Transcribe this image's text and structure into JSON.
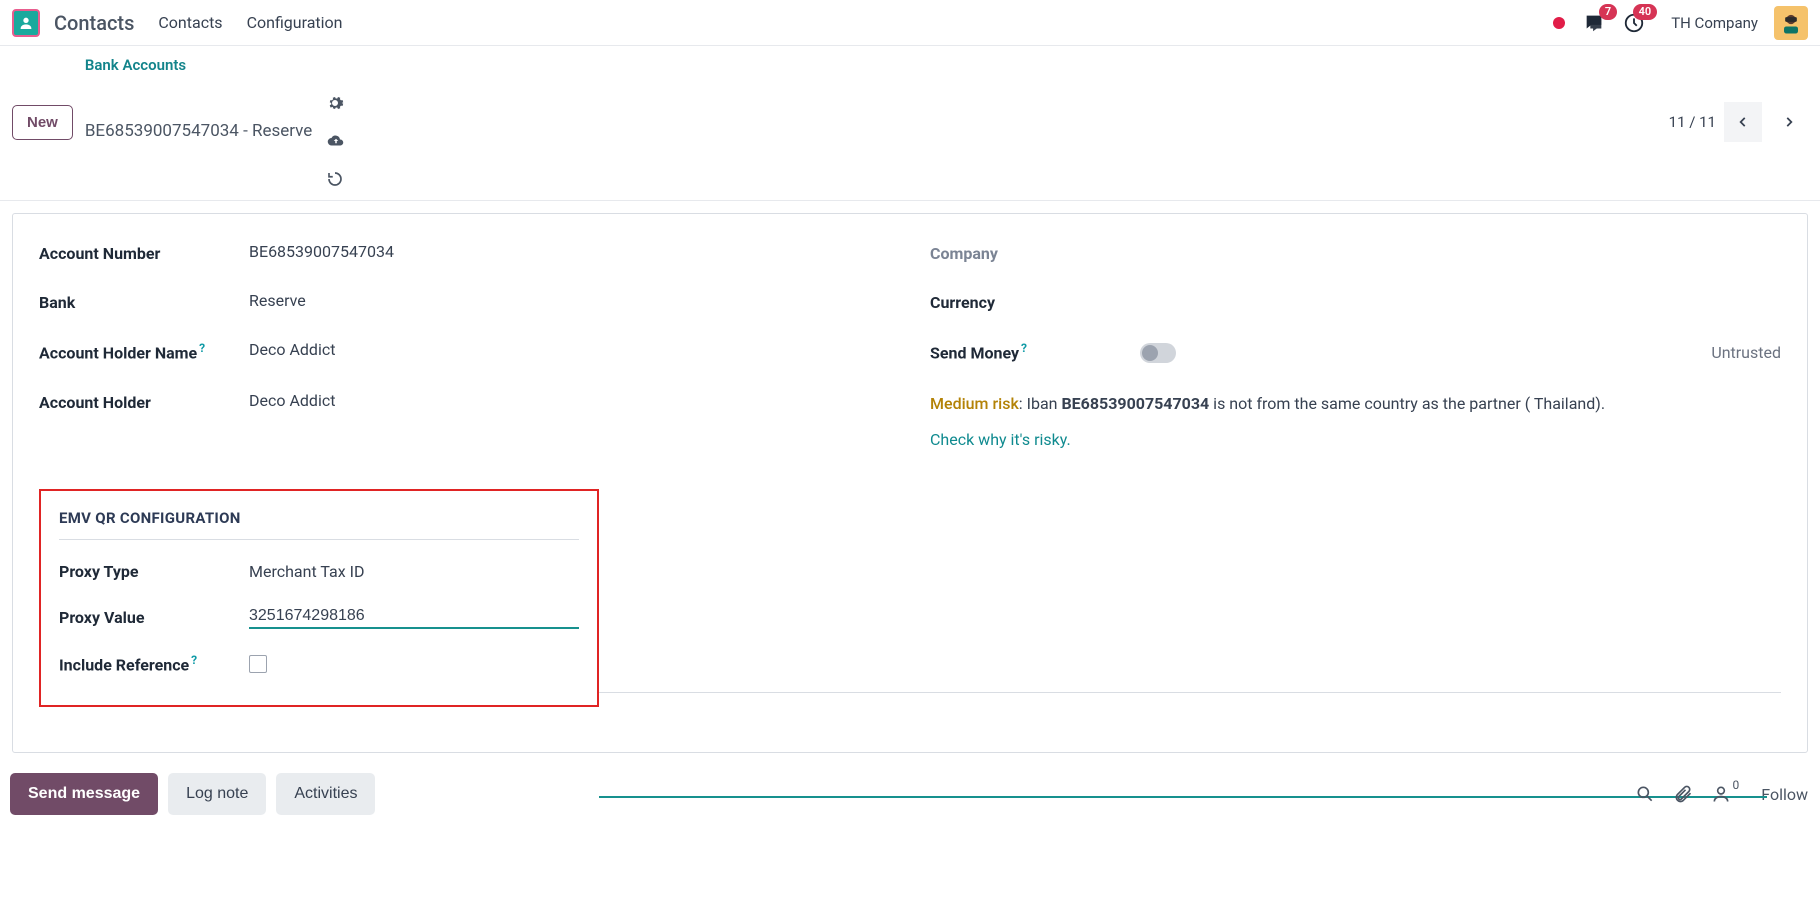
{
  "nav": {
    "app_name": "Contacts",
    "menu": [
      "Contacts",
      "Configuration"
    ],
    "messages_badge": "7",
    "activities_badge": "40",
    "company": "TH Company"
  },
  "breadcrumb": {
    "new_label": "New",
    "parent": "Bank Accounts",
    "current": "BE68539007547034 - Reserve"
  },
  "pager": {
    "text": "11 / 11"
  },
  "form": {
    "left": {
      "account_number": {
        "label": "Account Number",
        "value": "BE68539007547034"
      },
      "bank": {
        "label": "Bank",
        "value": "Reserve"
      },
      "holder_name": {
        "label": "Account Holder Name",
        "value": "Deco Addict"
      },
      "account_holder": {
        "label": "Account Holder",
        "value": "Deco Addict"
      }
    },
    "right": {
      "company": {
        "label": "Company",
        "value": ""
      },
      "currency": {
        "label": "Currency",
        "value": ""
      },
      "send_money": {
        "label": "Send Money",
        "status": "Untrusted"
      },
      "risk": {
        "level": "Medium risk",
        "sep": ": Iban ",
        "iban": "BE68539007547034",
        "tail": " is not from the same country as the partner ( Thailand).",
        "link": "Check why it's risky."
      }
    },
    "emv": {
      "title": "EMV QR CONFIGURATION",
      "proxy_type": {
        "label": "Proxy Type",
        "value": "Merchant Tax ID"
      },
      "proxy_value": {
        "label": "Proxy Value",
        "value": "3251674298186"
      },
      "include_ref": {
        "label": "Include Reference"
      }
    }
  },
  "footer": {
    "send": "Send message",
    "log": "Log note",
    "activities": "Activities",
    "follow": "Follow",
    "follower_count": "0"
  }
}
